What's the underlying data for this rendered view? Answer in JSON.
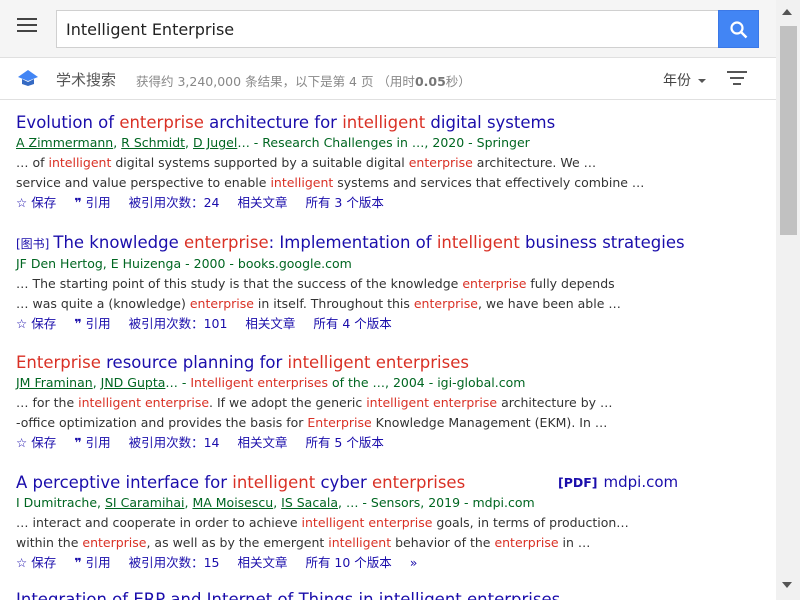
{
  "search": {
    "query": "Intelligent Enterprise"
  },
  "icons": {
    "menu": "menu-icon",
    "search": "search-icon",
    "logo": "scholar-logo-icon",
    "filter": "filter-icon",
    "star": "star-icon",
    "quote": "quote-icon",
    "more": "more-icon"
  },
  "colors": {
    "accent": "#4285f4",
    "link": "#1a0dab",
    "highlight": "#d93025",
    "meta": "#006621"
  },
  "header": {
    "scholar_title": "学术搜索",
    "stats_prefix": "获得约 3,240,000 条结果，以下是第 4 页 （用时",
    "stats_time": "0.05",
    "stats_suffix": "秒）",
    "year_label": "年份"
  },
  "results": [
    {
      "tag": "",
      "title_parts": [
        "Evolution of ",
        "enterprise",
        " architecture for ",
        "intelligent",
        " digital systems"
      ],
      "authors": [
        "A Zimmermann",
        "R Schmidt",
        "D Jugel"
      ],
      "meta_suffix": "… - Research Challenges in …, 2020 - Springer",
      "snippet1": [
        "… of ",
        "intelligent",
        " digital systems supported by a suitable digital ",
        "enterprise",
        " architecture. We …"
      ],
      "snippet2": [
        "service and value perspective to enable ",
        "intelligent",
        " systems and services that effectively combine …"
      ],
      "save": "保存",
      "cite": "引用",
      "cited_by": "被引用次数：24",
      "related": "相关文章",
      "versions": "所有 3 个版本"
    },
    {
      "tag": "[图书]",
      "title_parts": [
        "The knowledge ",
        "enterprise",
        ": Implementation of ",
        "intelligent",
        " business strategies"
      ],
      "authors_plain": "JF Den Hertog, E Huizenga - 2000 - books.google.com",
      "snippet1": [
        "… The starting point of this study is that the success of the knowledge ",
        "enterprise",
        " fully depends"
      ],
      "snippet2": [
        "… was quite a (knowledge) ",
        "enterprise",
        " in itself. Throughout this ",
        "enterprise",
        ", we have been able …"
      ],
      "save": "保存",
      "cite": "引用",
      "cited_by": "被引用次数：101",
      "related": "相关文章",
      "versions": "所有 4 个版本"
    },
    {
      "tag": "",
      "title_parts": [
        "Enterprise",
        " resource planning for ",
        "intelligent enterprises",
        ""
      ],
      "authors": [
        "JM Framinan",
        "JND Gupta"
      ],
      "meta_mid": "… - ",
      "meta_hl": "Intelligent enterprises",
      "meta_suffix": " of the …, 2004 - igi-global.com",
      "snippet1": [
        "… for the ",
        "intelligent enterprise",
        ". If we adopt the generic ",
        "intelligent enterprise",
        " architecture by …"
      ],
      "snippet2": [
        "-office optimization and provides the basis for ",
        "Enterprise",
        " Knowledge Management (EKM). In …"
      ],
      "save": "保存",
      "cite": "引用",
      "cited_by": "被引用次数：14",
      "related": "相关文章",
      "versions": "所有 5 个版本"
    },
    {
      "tag": "",
      "title_parts": [
        "A perceptive interface for ",
        "intelligent",
        " cyber ",
        "enterprises"
      ],
      "authors_lead": "I Dumitrache, ",
      "authors": [
        "SI Caramihai",
        "MA Moisescu",
        "IS Sacala"
      ],
      "meta_suffix": "… - Sensors, 2019 - mdpi.com",
      "snippet1": [
        "… interact and cooperate in order to achieve ",
        "intelligent enterprise",
        " goals, in terms of production…"
      ],
      "snippet2": [
        "within the ",
        "enterprise",
        ", as well as by the emergent ",
        "intelligent",
        " behavior of the ",
        "enterprise",
        " in …"
      ],
      "save": "保存",
      "cite": "引用",
      "cited_by": "被引用次数：15",
      "related": "相关文章",
      "versions": "所有 10 个版本",
      "pdf_tag": "[PDF]",
      "pdf_host": "mdpi.com"
    }
  ],
  "partial_next": "Integration of ERP and Internet of Things in intelligent enterprises …"
}
